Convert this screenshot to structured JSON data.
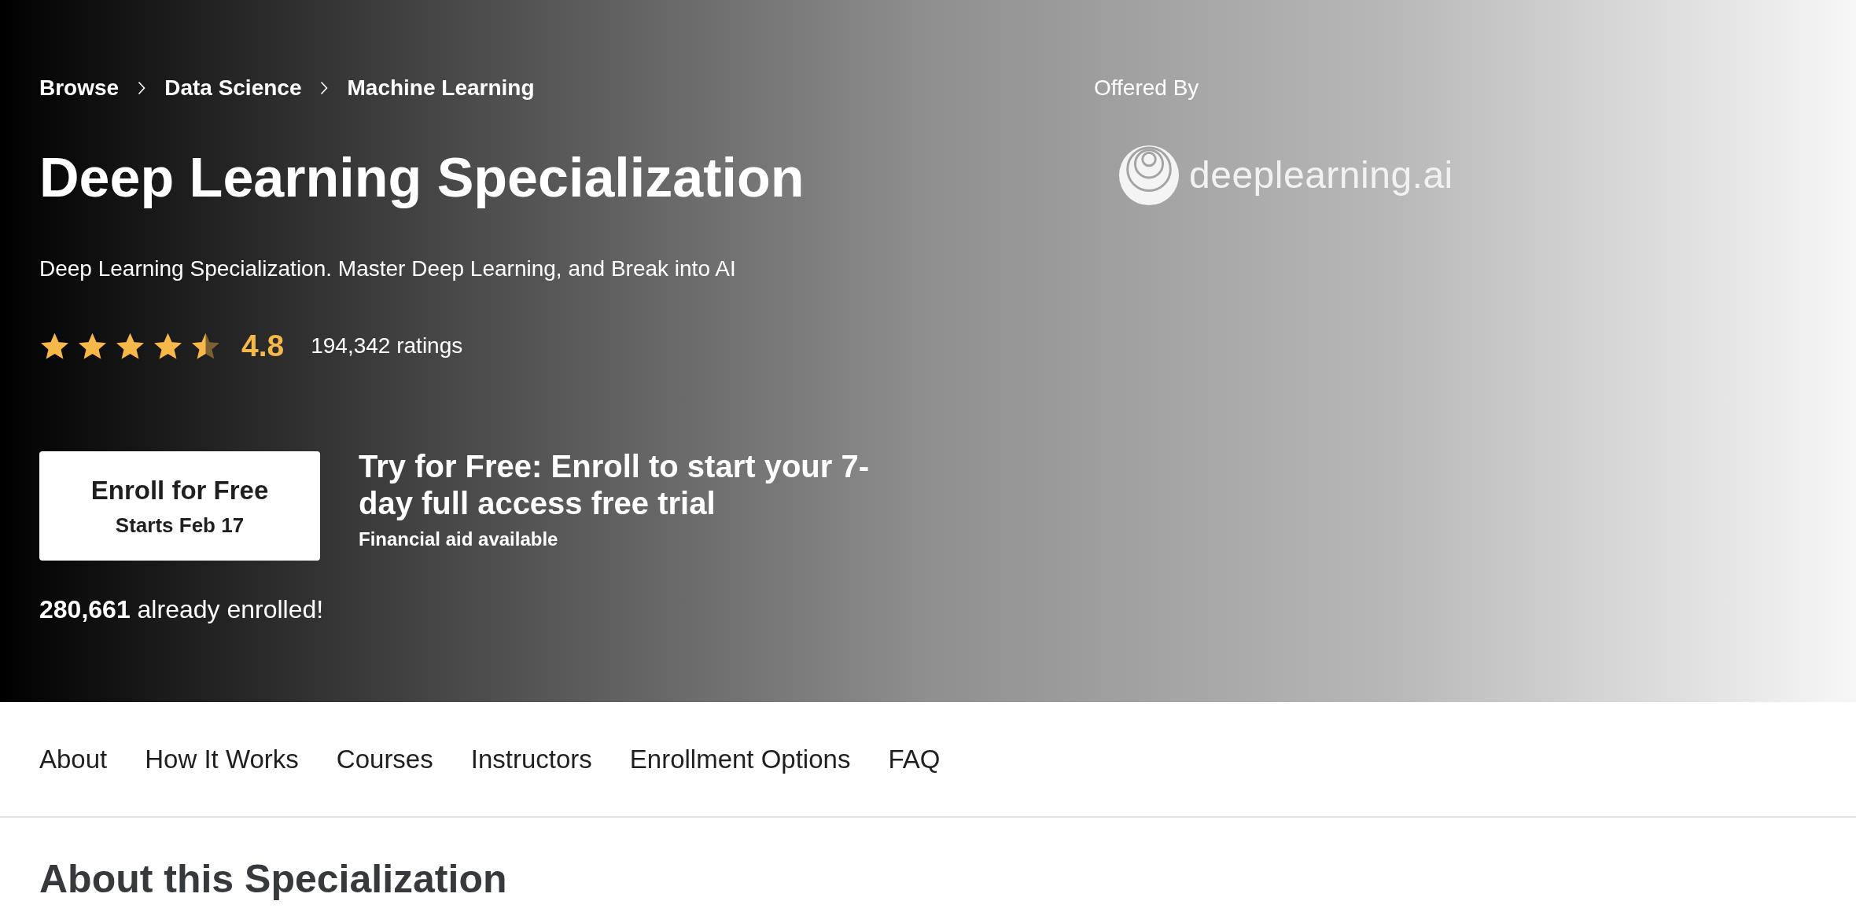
{
  "breadcrumb": [
    {
      "label": "Browse"
    },
    {
      "label": "Data Science"
    },
    {
      "label": "Machine Learning"
    }
  ],
  "hero": {
    "title": "Deep Learning Specialization",
    "subtitle": "Deep Learning Specialization. Master Deep Learning, and Break into AI",
    "rating": {
      "stars": 4.5,
      "score": "4.8",
      "count": "194,342 ratings"
    },
    "enroll_button": {
      "label": "Enroll for Free",
      "sublabel": "Starts Feb 17"
    },
    "trial": {
      "headline": "Try for Free: Enroll to start your 7-day full access free trial",
      "note": "Financial aid available"
    },
    "enrolled": "**280,661** already enrolled!"
  },
  "offered_by": {
    "label": "Offered By",
    "partner": "deeplearning.ai"
  },
  "nav": [
    {
      "label": "About"
    },
    {
      "label": "How It Works"
    },
    {
      "label": "Courses"
    },
    {
      "label": "Instructors"
    },
    {
      "label": "Enrollment Options"
    },
    {
      "label": "FAQ"
    }
  ],
  "section": {
    "heading": "About this Specialization"
  }
}
